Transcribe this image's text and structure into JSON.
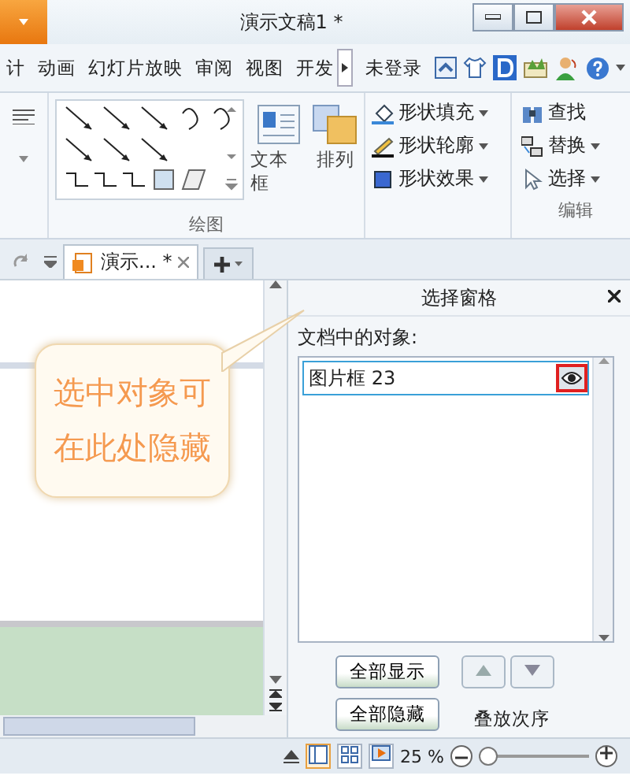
{
  "window": {
    "title": "演示文稿1 *"
  },
  "menu_tabs": [
    {
      "label": "计",
      "selected": false
    },
    {
      "label": "动画",
      "selected": false
    },
    {
      "label": "幻灯片放映",
      "selected": false
    },
    {
      "label": "审阅",
      "selected": false
    },
    {
      "label": "视图",
      "selected": false
    },
    {
      "label": "开发",
      "selected": false
    }
  ],
  "login": "未登录",
  "ribbon": {
    "drawing_group_label": "绘图",
    "text_box": "文本框",
    "arrange": "排列",
    "shape_commands": [
      "形状填充",
      "形状轮廓",
      "形状效果"
    ],
    "edit_commands": [
      {
        "label": "查找",
        "dropdown": false
      },
      {
        "label": "替换",
        "dropdown": true
      },
      {
        "label": "选择",
        "dropdown": true
      }
    ],
    "edit_group_label": "编辑"
  },
  "doc_tab": {
    "label": "演示... *",
    "selected": true
  },
  "pane": {
    "title": "选择窗格",
    "objects_label": "文档中的对象:",
    "objects": [
      {
        "name": "图片框 23",
        "selected": true,
        "visible": true
      }
    ],
    "show_all": "全部显示",
    "hide_all": "全部隐藏",
    "order_label": "叠放次序"
  },
  "status_bar": {
    "zoom": "25 %",
    "zoom_slider": {
      "level": 0.08
    }
  },
  "callout": {
    "lines": [
      "选中对象可",
      "在此处隐藏"
    ]
  }
}
